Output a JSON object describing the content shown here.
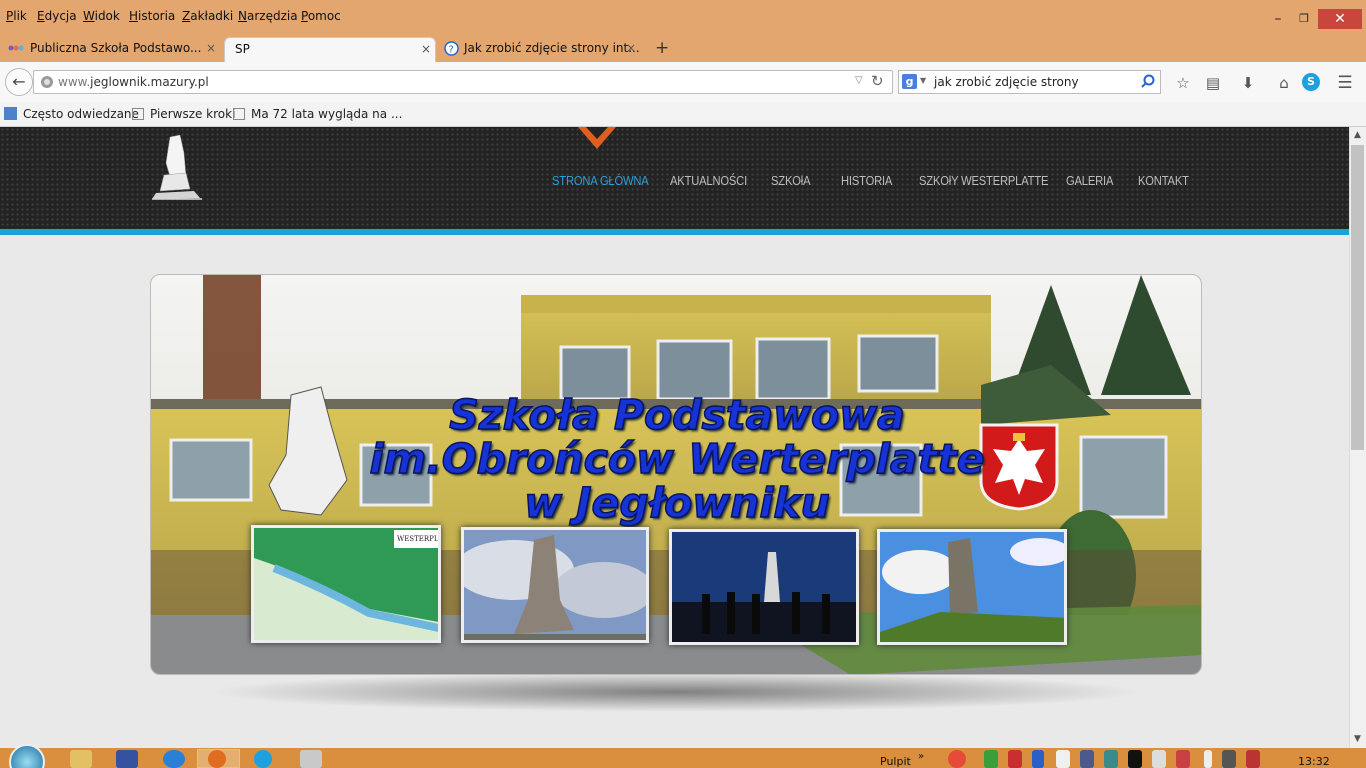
{
  "menu": [
    "Plik",
    "Edycja",
    "Widok",
    "Historia",
    "Zakładki",
    "Narzędzia",
    "Pomoc"
  ],
  "menu_accelerators": [
    "P",
    "E",
    "W",
    "H",
    "Z",
    "N",
    "P"
  ],
  "menu_rest": [
    "lik",
    "dycja",
    "idok",
    "istoria",
    "akładki",
    "arzędzia",
    "omoc"
  ],
  "tabs": [
    {
      "title": "Publiczna Szkoła Podstawo...",
      "close": "×"
    },
    {
      "title": "SP",
      "close": "×"
    },
    {
      "title": "Jak zrobić zdjęcie strony int...",
      "close": "×"
    }
  ],
  "new_tab": "+",
  "address": {
    "url_prefix": "www.",
    "url_host": "jeglownik.mazury.pl"
  },
  "search": {
    "value": "jak zrobić zdjęcie strony",
    "engine_icon": "google-icon"
  },
  "bookmarks": [
    "Często odwiedzane",
    "Pierwsze kroki",
    "Ma 72 lata wygląda na ..."
  ],
  "site": {
    "nav": [
      "STRONA GŁÓWNA",
      "AKTUALNOŚCI",
      "SZKOłA",
      "HISTORIA",
      "SZKOłY WESTERPLATTE",
      "GALERIA",
      "KONTAKT"
    ],
    "active_nav": "STRONA GŁÓWNA",
    "banner": {
      "line1": "Szkoła Podstawowa",
      "line2": "im.Obrońców Werterplatte",
      "line3": "w Jegłowniku",
      "map_label": "WESTERPLATTE"
    },
    "colors": {
      "header": "#232323",
      "accent_blue": "#1da2d8",
      "accent_orange": "#e05e1e",
      "active_link": "#2d9ed8"
    }
  },
  "taskbar": {
    "desktop_label": "Pulpit",
    "time": "13:32"
  },
  "window_controls": [
    "–",
    "❐",
    "✕"
  ]
}
